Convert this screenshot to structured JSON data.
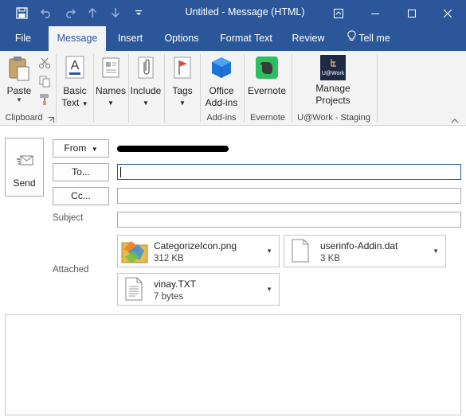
{
  "window": {
    "title": "Untitled  -  Message (HTML)"
  },
  "tabs": [
    {
      "label": "File"
    },
    {
      "label": "Message"
    },
    {
      "label": "Insert"
    },
    {
      "label": "Options"
    },
    {
      "label": "Format Text"
    },
    {
      "label": "Review"
    },
    {
      "label": "Tell me"
    }
  ],
  "ribbon": {
    "paste_label": "Paste",
    "basic_text_label_1": "Basic",
    "basic_text_label_2": "Text",
    "names_label": "Names",
    "include_label": "Include",
    "tags_label": "Tags",
    "office_addins_label_1": "Office",
    "office_addins_label_2": "Add-ins",
    "evernote_label": "Evernote",
    "manage_projects_label_1": "Manage",
    "manage_projects_label_2": "Projects",
    "uwork_logo_text": "U@Work",
    "groups": {
      "clipboard": "Clipboard",
      "addins": "Add-ins",
      "evernote": "Evernote",
      "uwork": "U@Work - Staging"
    }
  },
  "compose": {
    "send_label": "Send",
    "from_label": "From",
    "to_label": "To...",
    "cc_label": "Cc...",
    "subject_label": "Subject",
    "attached_label": "Attached",
    "to_value": "",
    "cc_value": "",
    "subject_value": "",
    "attachments": [
      {
        "name": "CategorizeIcon.png",
        "size": "312 KB"
      },
      {
        "name": "userinfo-Addin.dat",
        "size": "3 KB"
      },
      {
        "name": "vinay.TXT",
        "size": "7 bytes"
      }
    ]
  },
  "colors": {
    "accent": "#2b579a",
    "ribbon_bg": "#f3f3f3",
    "office_icon": "#1e73d6",
    "evernote_green": "#2dbe60",
    "tags_flag": "#e64a36"
  }
}
